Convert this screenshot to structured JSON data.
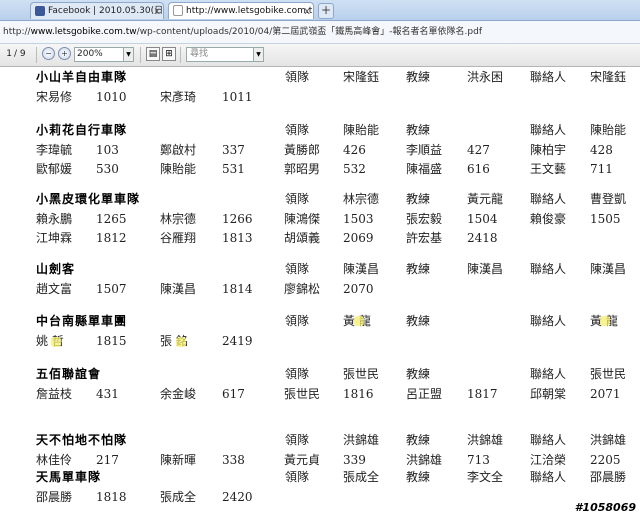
{
  "browser": {
    "tabs": [
      {
        "title": "Facebook | 2010.05.30(日)...",
        "active": false
      },
      {
        "title": "http://www.letsgobike.com.t...",
        "active": true
      }
    ],
    "new_tab": "+",
    "close": "x",
    "url_prefix": "http://",
    "url_host": "www.letsgobike.com.tw",
    "url_path": "/wp-content/uploads/2010/04/第二屆武嶺盃「鐵馬高峰會」-報名者名單依隊名.pdf",
    "favicon_colors": {
      "facebook": "#3b5998",
      "page": "#ffffff"
    }
  },
  "pdf_toolbar": {
    "page_number": "1",
    "page_total": "/ 9",
    "zoom_value": "200%",
    "find_placeholder": "尋找",
    "dropdown_glyph": "▼"
  },
  "document": {
    "teams": [
      {
        "name": "小山羊自由車隊",
        "leader_label": "領隊",
        "leader": "宋隆鈺",
        "coach_label": "教練",
        "coach": "洪永困",
        "contact_label": "聯絡人",
        "contact": "宋隆鈺",
        "rows": [
          [
            "宋易修",
            "1010",
            "宋彥琦",
            "1011"
          ]
        ]
      },
      {
        "name": "小莉花自行車隊",
        "leader_label": "領隊",
        "leader": "陳貽能",
        "coach_label": "教練",
        "coach": "",
        "contact_label": "聯絡人",
        "contact": "陳貽能",
        "rows": [
          [
            "李瑋毓",
            "103",
            "鄭啟村",
            "337",
            "黃勝郎",
            "426",
            "李順益",
            "427",
            "陳柏宇",
            "428"
          ],
          [
            "歐郁媛",
            "530",
            "陳貽能",
            "531",
            "郭昭男",
            "532",
            "陳福盛",
            "616",
            "王文藝",
            "711"
          ]
        ]
      },
      {
        "name": "小黑皮環化單車隊",
        "leader_label": "領隊",
        "leader": "林宗德",
        "coach_label": "教練",
        "coach": "黃元龍",
        "contact_label": "聯絡人",
        "contact": "曹登凱",
        "rows": [
          [
            "賴永鵬",
            "1265",
            "林宗德",
            "1266",
            "陳鴻傑",
            "1503",
            "張宏毅",
            "1504",
            "賴俊豪",
            "1505"
          ],
          [
            "江坤霖",
            "1812",
            "谷雁翔",
            "1813",
            "胡頌義",
            "2069",
            "許宏基",
            "2418"
          ]
        ]
      },
      {
        "name": "山劍客",
        "leader_label": "領隊",
        "leader": "陳漢昌",
        "coach_label": "教練",
        "coach": "陳漢昌",
        "contact_label": "聯絡人",
        "contact": "陳漢昌",
        "rows": [
          [
            "趙文富",
            "1507",
            "陳漢昌",
            "1814",
            "廖錦松",
            "2070"
          ]
        ]
      },
      {
        "name": "中台南縣單車團",
        "leader_label": "領隊",
        "leader": "黃 龍",
        "coach_label": "教練",
        "coach": "",
        "contact_label": "聯絡人",
        "contact": "黃 龍",
        "rows": [
          [
            "姚 哲",
            "1815",
            "張 銘",
            "2419"
          ]
        ]
      },
      {
        "name": "五佰聯誼會",
        "leader_label": "領隊",
        "leader": "張世民",
        "coach_label": "教練",
        "coach": "",
        "contact_label": "聯絡人",
        "contact": "張世民",
        "rows": [
          [
            "詹益枝",
            "431",
            "余金峻",
            "617",
            "張世民",
            "1816",
            "呂正盟",
            "1817",
            "邱朝棠",
            "2071"
          ]
        ]
      },
      {
        "name": "天不怕地不怕隊",
        "leader_label": "領隊",
        "leader": "洪錦雄",
        "coach_label": "教練",
        "coach": "洪錦雄",
        "contact_label": "聯絡人",
        "contact": "洪錦雄",
        "rows": [
          [
            "林佳伶",
            "217",
            "陳新暉",
            "338",
            "黃元貞",
            "339",
            "洪錦雄",
            "713",
            "江洽榮",
            "2205"
          ]
        ]
      },
      {
        "name": "天馬單車隊",
        "leader_label": "領隊",
        "leader": "張成全",
        "coach_label": "教練",
        "coach": "李文全",
        "contact_label": "聯絡人",
        "contact": "邵晨勝",
        "rows": [
          [
            "邵晨勝",
            "1818",
            "張成全",
            "2420"
          ]
        ]
      }
    ]
  },
  "watermark": "#1058069"
}
